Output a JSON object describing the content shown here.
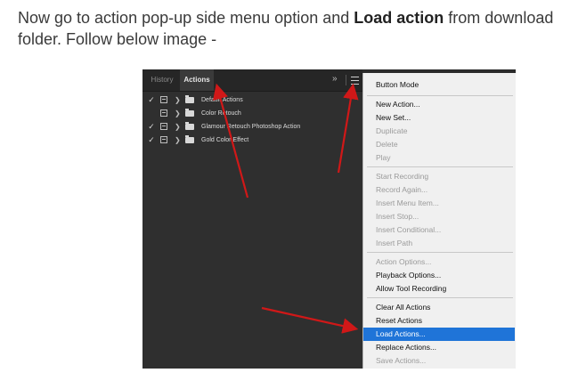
{
  "caption": {
    "before": "Now go to action pop-up side menu option and ",
    "bold": "Load action",
    "after": " from download folder. Follow below image -"
  },
  "panel": {
    "tabs": [
      "History",
      "Actions"
    ],
    "double_arrow": "»",
    "actions": [
      {
        "label": "Default Actions",
        "checked": true
      },
      {
        "label": "Color Retouch",
        "checked": false
      },
      {
        "label": "Glamour Retouch Photoshop Action",
        "checked": true
      },
      {
        "label": "Gold Color Effect",
        "checked": true
      }
    ]
  },
  "menu": {
    "items": [
      {
        "label": "Button Mode",
        "enabled": true
      },
      {
        "label": "New Action...",
        "enabled": true
      },
      {
        "label": "New Set...",
        "enabled": true
      },
      {
        "label": "Duplicate",
        "enabled": false
      },
      {
        "label": "Delete",
        "enabled": false
      },
      {
        "label": "Play",
        "enabled": false
      },
      {
        "label": "Start Recording",
        "enabled": false
      },
      {
        "label": "Record Again...",
        "enabled": false
      },
      {
        "label": "Insert Menu Item...",
        "enabled": false
      },
      {
        "label": "Insert Stop...",
        "enabled": false
      },
      {
        "label": "Insert Conditional...",
        "enabled": false
      },
      {
        "label": "Insert Path",
        "enabled": false
      },
      {
        "label": "Action Options...",
        "enabled": false
      },
      {
        "label": "Playback Options...",
        "enabled": true
      },
      {
        "label": "Allow Tool Recording",
        "enabled": true
      },
      {
        "label": "Clear All Actions",
        "enabled": true
      },
      {
        "label": "Reset Actions",
        "enabled": true
      },
      {
        "label": "Load Actions...",
        "enabled": true,
        "selected": true
      },
      {
        "label": "Replace Actions...",
        "enabled": true
      },
      {
        "label": "Save Actions...",
        "enabled": false
      }
    ]
  },
  "colors": {
    "arrow": "#d01818",
    "highlight": "#1f74d8",
    "panel_bg": "#2f2f2f",
    "menu_bg": "#f0f0f0"
  },
  "icons": [
    "checkmark-icon",
    "dialog-toggle-icon",
    "chevron-right-icon",
    "folder-icon",
    "panel-menu-icon",
    "expand-double-arrow-icon"
  ]
}
